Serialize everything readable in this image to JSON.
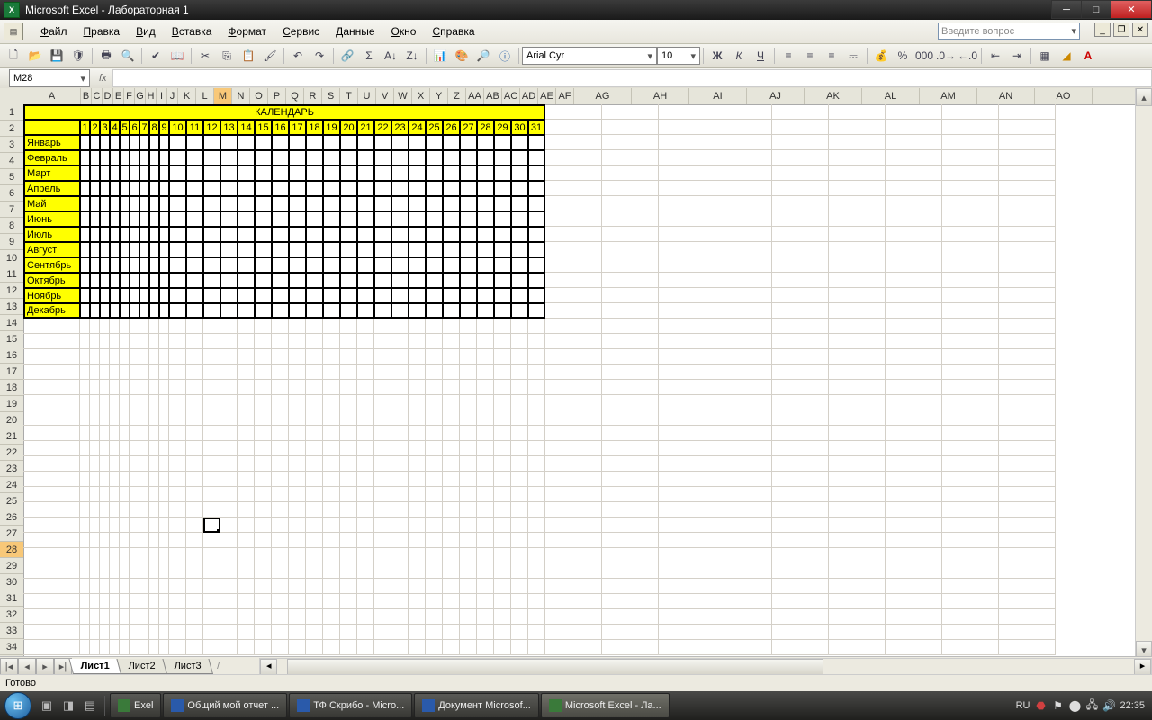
{
  "title": "Microsoft Excel - Лабораторная 1",
  "menus": [
    "Файл",
    "Правка",
    "Вид",
    "Вставка",
    "Формат",
    "Сервис",
    "Данные",
    "Окно",
    "Справка"
  ],
  "help_placeholder": "Введите вопрос",
  "namebox": "M28",
  "font": "Arial Cyr",
  "fontsize": "10",
  "columns_narrow": [
    "B",
    "C",
    "D",
    "E",
    "F",
    "G",
    "H",
    "I",
    "J",
    "K",
    "L",
    "M",
    "N",
    "O",
    "P",
    "Q",
    "R",
    "S",
    "T",
    "U",
    "V",
    "W",
    "X",
    "Y",
    "Z",
    "AA",
    "AB",
    "AC",
    "AD",
    "AE",
    "AF"
  ],
  "columns_wide": [
    "AG",
    "AH",
    "AI",
    "AJ",
    "AK",
    "AL",
    "AM",
    "AN",
    "AO"
  ],
  "active_col": "M",
  "active_row": 28,
  "calendar_title": "КАЛЕНДАРЬ",
  "days": [
    "1",
    "2",
    "3",
    "4",
    "5",
    "6",
    "7",
    "8",
    "9",
    "10",
    "11",
    "12",
    "13",
    "14",
    "15",
    "16",
    "17",
    "18",
    "19",
    "20",
    "21",
    "22",
    "23",
    "24",
    "25",
    "26",
    "27",
    "28",
    "29",
    "30",
    "31"
  ],
  "months": [
    "Январь",
    "Февраль",
    "Март",
    "Апрель",
    "Май",
    "Июнь",
    "Июль",
    "Август",
    "Сентябрь",
    "Октябрь",
    "Ноябрь",
    "Декабрь"
  ],
  "sheets": [
    "Лист1",
    "Лист2",
    "Лист3"
  ],
  "active_sheet": "Лист1",
  "status": "Готово",
  "taskbar": [
    {
      "label": "Exel",
      "icon": "x"
    },
    {
      "label": "Общий мой отчет ...",
      "icon": "w"
    },
    {
      "label": "ТФ Скрибо - Micro...",
      "icon": "w"
    },
    {
      "label": "Документ Microsof...",
      "icon": "w"
    },
    {
      "label": "Microsoft Excel - Ла...",
      "icon": "x",
      "active": true
    }
  ],
  "lang": "RU",
  "time": "22:35"
}
